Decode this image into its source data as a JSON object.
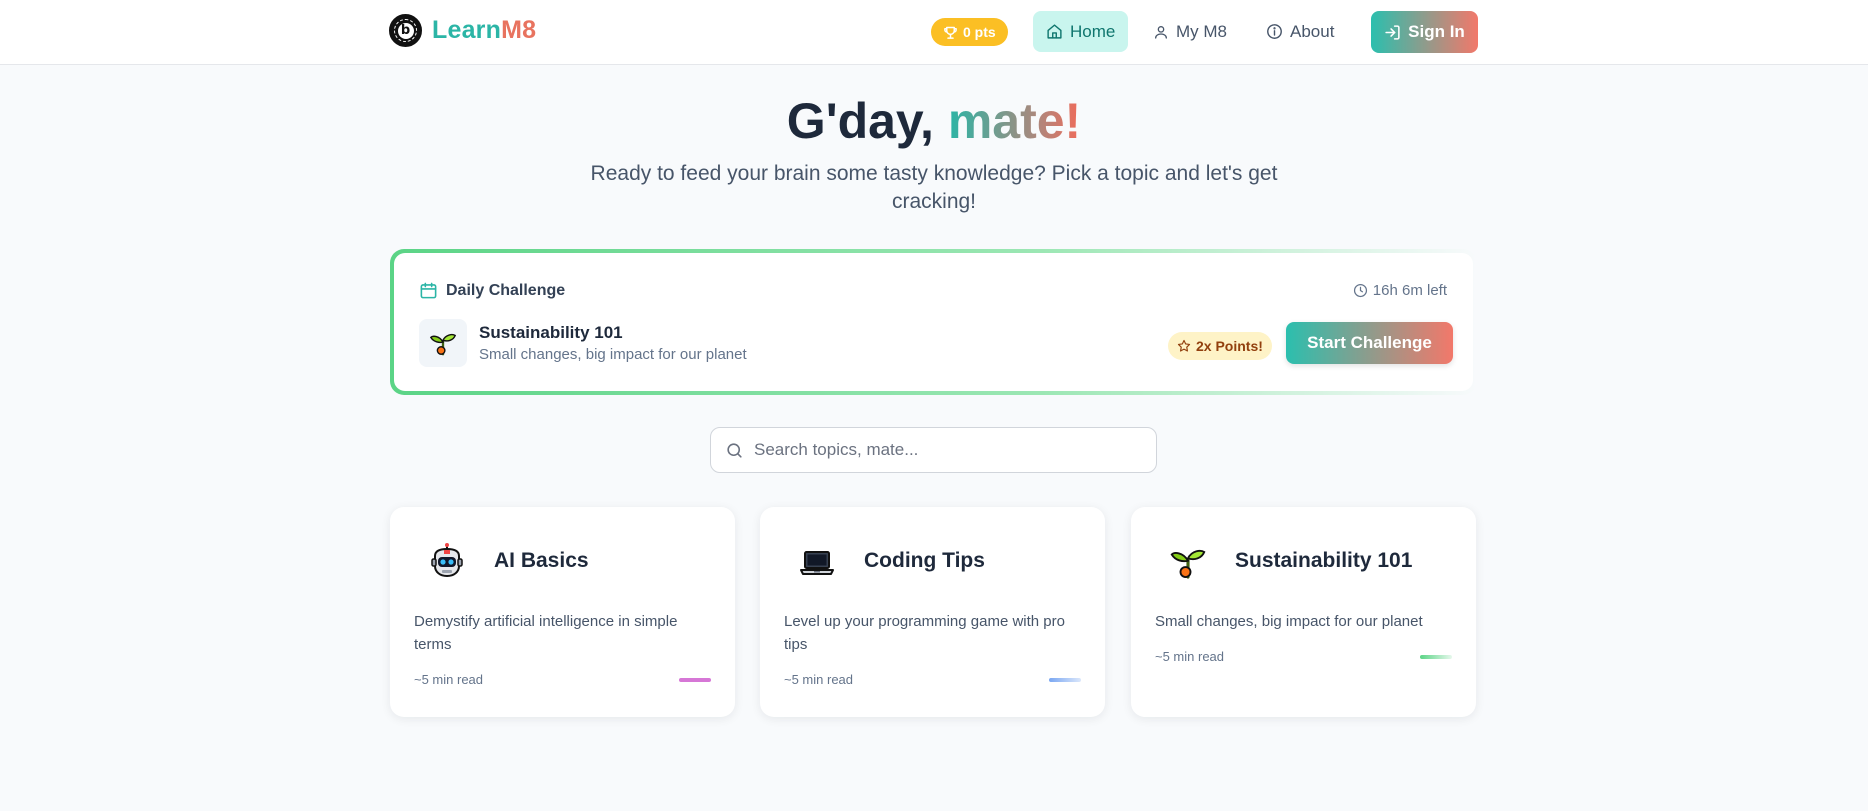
{
  "header": {
    "brand_part1": "Learn",
    "brand_part2": "M8",
    "logo_glyph": "b",
    "points": "0 pts",
    "nav": [
      {
        "label": "Home",
        "icon": "home-icon",
        "active": true
      },
      {
        "label": "My M8",
        "icon": "user-icon",
        "active": false
      },
      {
        "label": "About",
        "icon": "info-icon",
        "active": false
      }
    ],
    "sign_in": "Sign In"
  },
  "hero": {
    "greeting": "G'day, ",
    "highlight": "mate!",
    "subtitle": "Ready to feed your brain some tasty knowledge? Pick a topic and let's get cracking!"
  },
  "daily_challenge": {
    "heading": "Daily Challenge",
    "time_left": "16h 6m left",
    "topic_title": "Sustainability 101",
    "topic_desc": "Small changes, big impact for our planet",
    "badge": "2x Points!",
    "start_label": "Start Challenge"
  },
  "search": {
    "placeholder": "Search topics, mate...",
    "value": ""
  },
  "topics": [
    {
      "title": "AI Basics",
      "desc": "Demystify artificial intelligence in simple terms",
      "meta": "~5 min read",
      "icon": "robot-icon",
      "accent": "#d677d6"
    },
    {
      "title": "Coding Tips",
      "desc": "Level up your programming game with pro tips",
      "meta": "~5 min read",
      "icon": "laptop-icon",
      "accent": "#7aa7f2"
    },
    {
      "title": "Sustainability 101",
      "desc": "Small changes, big impact for our planet",
      "meta": "~5 min read",
      "icon": "seedling-icon",
      "accent": "#5bd486"
    }
  ],
  "colors": {
    "brand_teal": "#2bb5a6",
    "brand_coral": "#e8735f",
    "points_amber": "#fbbf24",
    "home_active_bg": "#c9f5ee"
  }
}
